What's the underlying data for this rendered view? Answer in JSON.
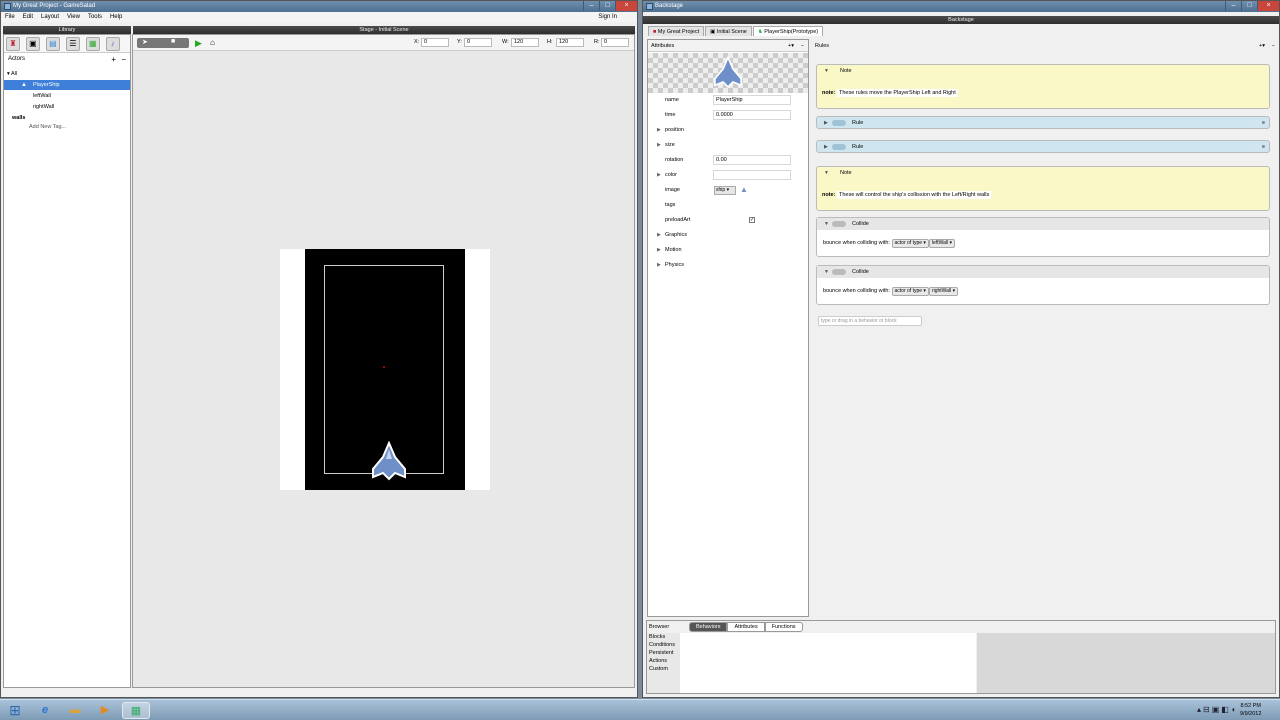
{
  "left_window": {
    "title": "My Great Project - GameSalad",
    "menu": [
      "File",
      "Edit",
      "Layout",
      "View",
      "Tools",
      "Help"
    ],
    "sign_in": "Sign In",
    "library_label": "Library",
    "stage_label": "Stage - Initial Scene",
    "actors_label": "Actors",
    "tree": {
      "all": "All",
      "items": [
        "PlayerShip",
        "leftWall",
        "rightWall"
      ],
      "tag_walls": "walls",
      "add_tag": "Add New Tag..."
    },
    "stage_coords": {
      "x_label": "X:",
      "x_value": "0",
      "y_label": "Y:",
      "y_value": "0",
      "w_label": "W:",
      "w_value": "120",
      "h_label": "H:",
      "h_value": "120",
      "r_label": "R:",
      "r_value": "0"
    }
  },
  "right_window": {
    "title": "Backstage",
    "backstage_label": "Backstage",
    "tabs": [
      "My Great Project",
      "Initial Scene",
      "PlayerShip(Prototype)"
    ],
    "attributes_label": "Attributes",
    "rules_label": "Rules",
    "attributes": {
      "name_label": "name",
      "name_value": "PlayerShip",
      "time_label": "time",
      "time_value": "0.0000",
      "position_label": "position",
      "size_label": "size",
      "rotation_label": "rotation",
      "rotation_value": "0.00",
      "color_label": "color",
      "image_label": "image",
      "image_value": "ship",
      "tags_label": "tags",
      "preload_label": "preloadArt",
      "graphics_label": "Graphics",
      "motion_label": "Motion",
      "physics_label": "Physics"
    },
    "rules": {
      "note1_title": "Note",
      "note_key": "note:",
      "note1_text": "These rules move the PlayerShip Left and Right",
      "rule1_title": "Rule",
      "rule2_title": "Rule",
      "note2_title": "Note",
      "note2_text": "These will control the ship's collission with the Left/Right walls",
      "collide1_title": "Collide",
      "collide_text": "bounce when colliding with:",
      "actor_of_type": "actor of type",
      "collide1_target": "leftWall",
      "collide2_title": "Collide",
      "collide2_target": "rightWall",
      "drop_placeholder": "type or drag in a behavior or block"
    },
    "browser": {
      "label": "Browser",
      "tabs": [
        "Behaviors",
        "Attributes",
        "Functions"
      ],
      "categories": [
        "Blocks",
        "Conditions",
        "Persistent",
        "Actions",
        "Custom"
      ]
    }
  },
  "taskbar": {
    "time": "8:52 PM",
    "date": "9/9/2012"
  },
  "colors": {
    "selection": "#3d7fd9",
    "note_bg": "#fbf8c8",
    "rule_bg": "#cfe6f0",
    "collide_bg": "#e6e6e6"
  }
}
